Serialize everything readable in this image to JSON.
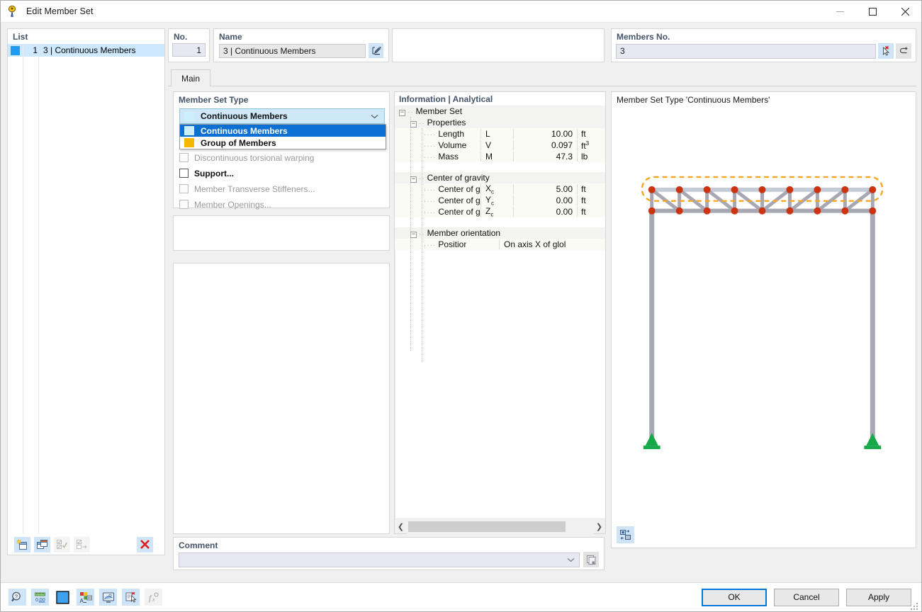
{
  "window": {
    "title": "Edit Member Set",
    "icon": "member-set-icon",
    "minimize": "–",
    "maximize": "☐",
    "close": "✕"
  },
  "list": {
    "label": "List",
    "rows": [
      {
        "swatch_color": "#1f9cf0",
        "index": "1",
        "name": "3 | Continuous Members",
        "selected": true
      }
    ],
    "toolbar": [
      {
        "name": "new-item-button",
        "enabled": true
      },
      {
        "name": "copy-item-button",
        "enabled": true
      },
      {
        "name": "select-all-button",
        "enabled": false
      },
      {
        "name": "invert-selection-button",
        "enabled": false
      },
      {
        "name": "delete-item-button",
        "enabled": true
      }
    ]
  },
  "header": {
    "no_label": "No.",
    "no_value": "1",
    "name_label": "Name",
    "name_value": "3 | Continuous Members",
    "name_edit_icon": "edit-pencil-icon",
    "members_label": "Members No.",
    "members_value": "3",
    "members_pick_icon": "pick-cursor-icon",
    "members_undo_icon": "undo-arrow-icon"
  },
  "tabs": [
    {
      "label": "Main",
      "active": true
    }
  ],
  "member_set_type": {
    "label": "Member Set Type",
    "selected": "Continuous Members",
    "selected_color": "#cdeefd",
    "dropdown_open": true,
    "options": [
      {
        "label": "Continuous Members",
        "color": "#cdeefd",
        "selected": true
      },
      {
        "label": "Group of Members",
        "color": "#f5b800",
        "selected": false
      }
    ],
    "checkboxes": [
      {
        "label": "Discontinuous torsional warping",
        "checked": false,
        "enabled": false
      },
      {
        "label": "Support...",
        "checked": false,
        "enabled": true
      },
      {
        "label": "Member Transverse Stiffeners...",
        "checked": false,
        "enabled": false
      },
      {
        "label": "Member Openings...",
        "checked": false,
        "enabled": false
      }
    ]
  },
  "comment": {
    "label": "Comment",
    "value": "",
    "placeholder": "",
    "chevron": "⌄",
    "copy_icon": "copy-comment-icon"
  },
  "information": {
    "title": "Information | Analytical",
    "scroll_left_icon": "❮",
    "scroll_right_icon": "❯",
    "rows": [
      {
        "kind": "group",
        "indent": 0,
        "expander": "−",
        "label": "Member Set",
        "symbol": "",
        "value": "",
        "unit": ""
      },
      {
        "kind": "group",
        "indent": 1,
        "expander": "−",
        "label": "Properties",
        "symbol": "",
        "value": "",
        "unit": ""
      },
      {
        "kind": "leaf",
        "indent": 2,
        "expander": "",
        "label": "Length",
        "symbol": "L",
        "value": "10.00",
        "unit": "ft"
      },
      {
        "kind": "leaf",
        "indent": 2,
        "expander": "",
        "label": "Volume",
        "symbol": "V",
        "value": "0.097",
        "unit": "ft³"
      },
      {
        "kind": "leaf",
        "indent": 2,
        "expander": "",
        "label": "Mass",
        "symbol": "M",
        "value": "47.3",
        "unit": "lb"
      },
      {
        "kind": "spacer",
        "indent": 0,
        "expander": "",
        "label": "",
        "symbol": "",
        "value": "",
        "unit": ""
      },
      {
        "kind": "group",
        "indent": 1,
        "expander": "−",
        "label": "Center of gravity",
        "symbol": "",
        "value": "",
        "unit": ""
      },
      {
        "kind": "leaf",
        "indent": 2,
        "expander": "",
        "label": "Center of gravity",
        "symbol": "Xc",
        "value": "5.00",
        "unit": "ft"
      },
      {
        "kind": "leaf",
        "indent": 2,
        "expander": "",
        "label": "Center of gravity",
        "symbol": "Yc",
        "value": "0.00",
        "unit": "ft"
      },
      {
        "kind": "leaf",
        "indent": 2,
        "expander": "",
        "label": "Center of gravity",
        "symbol": "Zc",
        "value": "0.00",
        "unit": "ft"
      },
      {
        "kind": "spacer",
        "indent": 0,
        "expander": "",
        "label": "",
        "symbol": "",
        "value": "",
        "unit": ""
      },
      {
        "kind": "group",
        "indent": 1,
        "expander": "−",
        "label": "Member orientation",
        "symbol": "",
        "value": "",
        "unit": ""
      },
      {
        "kind": "leaf",
        "indent": 2,
        "expander": "",
        "label": "Position",
        "symbol": "",
        "value": "On axis X of glol",
        "unit": "",
        "value_align": "left"
      }
    ]
  },
  "view": {
    "caption": "Member Set Type 'Continuous Members'",
    "tool_icon": "view-settings-icon",
    "colors": {
      "member": "#a8a8b4",
      "node": "#cc3311",
      "highlight_dash": "#f5a623",
      "support": "#17a84a",
      "chord_top": "#c3cbd6"
    }
  },
  "bottom_toolbar": [
    {
      "name": "info-magnifier-button",
      "icon": "magnifier-question-icon",
      "enabled": true
    },
    {
      "name": "units-button",
      "icon": "ruler-number-icon",
      "enabled": true
    },
    {
      "name": "color-swatch-button",
      "icon": "color-swatch-icon",
      "enabled": true,
      "color": "#3fa0ef"
    },
    {
      "name": "display-properties-button",
      "icon": "display-properties-icon",
      "enabled": true
    },
    {
      "name": "render-view-button",
      "icon": "render-view-icon",
      "enabled": true
    },
    {
      "name": "select-object-button",
      "icon": "select-object-icon",
      "enabled": true
    },
    {
      "name": "formula-button",
      "icon": "formula-icon",
      "enabled": false
    }
  ],
  "dialog_buttons": [
    {
      "label": "OK",
      "default": true
    },
    {
      "label": "Cancel",
      "default": false
    },
    {
      "label": "Apply",
      "default": false
    }
  ]
}
